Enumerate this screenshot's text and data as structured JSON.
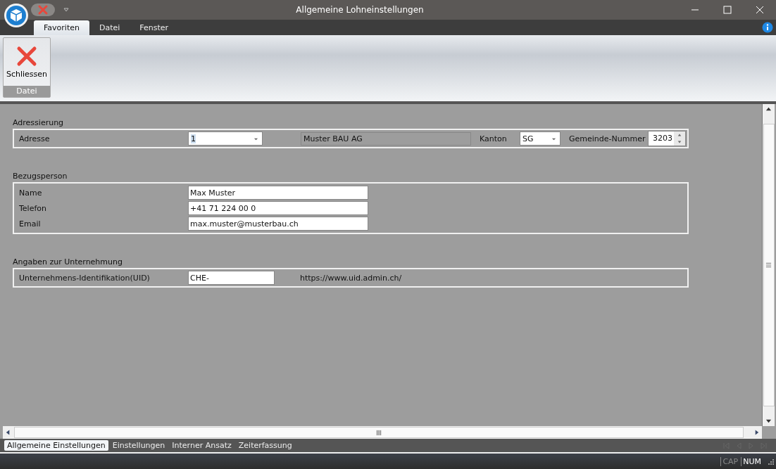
{
  "window": {
    "title": "Allgemeine Lohneinstellungen"
  },
  "menu_tabs": [
    {
      "label": "Favoriten",
      "selected": true
    },
    {
      "label": "Datei",
      "selected": false
    },
    {
      "label": "Fenster",
      "selected": false
    }
  ],
  "ribbon": {
    "buttons": [
      {
        "label": "Schliessen"
      }
    ],
    "group": "Datei"
  },
  "sections": [
    {
      "title": "Adressierung",
      "kind": "address",
      "label": "Adresse",
      "address_value": "1",
      "company": "Muster BAU AG",
      "canton_label": "Kanton",
      "canton_value": "SG",
      "municipality_label": "Gemeinde-Nummer",
      "municipality_value": "3203"
    },
    {
      "title": "Bezugsperson",
      "kind": "fields",
      "fields": [
        {
          "label": "Name",
          "value": "Max Muster"
        },
        {
          "label": "Telefon",
          "value": "+41 71 224 00 0"
        },
        {
          "label": "Email",
          "value": "max.muster@musterbau.ch"
        }
      ]
    },
    {
      "title": "Angaben zur Unternehmung",
      "kind": "uid",
      "label": "Unternehmens-Identifikation(UID)",
      "value": "CHE-",
      "link": "https://www.uid.admin.ch/"
    }
  ],
  "bottom_tabs": [
    {
      "label": "Allgemeine Einstellungen",
      "selected": true
    },
    {
      "label": "Einstellungen",
      "selected": false
    },
    {
      "label": "Interner Ansatz",
      "selected": false
    },
    {
      "label": "Zeiterfassung",
      "selected": false
    }
  ],
  "status_bar": [
    {
      "label": "CAP",
      "on": false
    },
    {
      "label": "NUM",
      "on": true
    }
  ]
}
